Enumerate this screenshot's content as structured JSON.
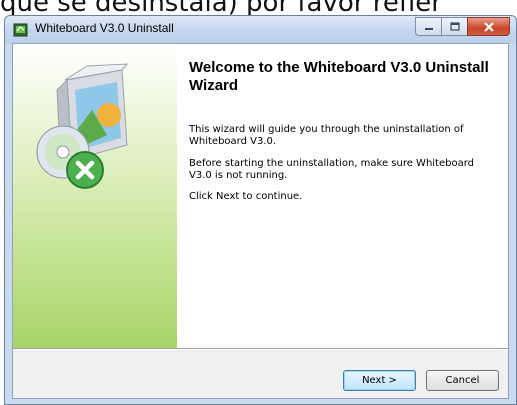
{
  "background": {
    "caption": "que se desinstala) por favor refiér"
  },
  "window": {
    "title": "Whiteboard V3.0 Uninstall",
    "controls": {
      "minimize_icon": "minimize-icon",
      "maximize_icon": "maximize-icon",
      "close_icon": "close-icon"
    }
  },
  "wizard": {
    "title": "Welcome to the Whiteboard V3.0 Uninstall Wizard",
    "paragraphs": [
      "This wizard will guide you through the uninstallation of Whiteboard V3.0.",
      "Before starting the uninstallation, make sure Whiteboard V3.0 is not running.",
      "Click Next to continue."
    ],
    "sidebar_icon": "uninstall-box-icon"
  },
  "buttons": {
    "next": "Next >",
    "cancel": "Cancel"
  },
  "colors": {
    "sidebar_green": "#a8d46a",
    "close_red": "#c9442a",
    "uninstall_badge": "#4caf50"
  }
}
